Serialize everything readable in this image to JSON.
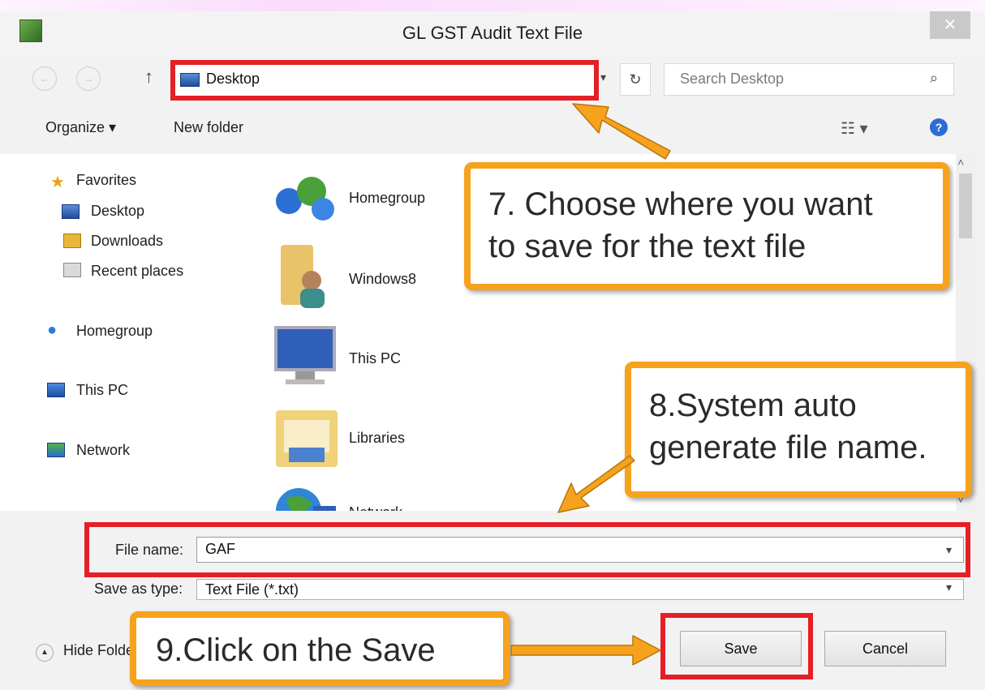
{
  "dialog": {
    "title": "GL GST Audit Text File",
    "close_glyph": "✕"
  },
  "address": {
    "location": "Desktop",
    "search_placeholder": "Search Desktop"
  },
  "toolbar": {
    "organize": "Organize ▾",
    "new_folder": "New folder"
  },
  "nav": {
    "favorites": "Favorites",
    "desktop": "Desktop",
    "downloads": "Downloads",
    "recent_places": "Recent places",
    "homegroup": "Homegroup",
    "this_pc": "This PC",
    "network": "Network"
  },
  "content_items": [
    "Homegroup",
    "Windows8",
    "This PC",
    "Libraries",
    "Network"
  ],
  "fields": {
    "file_name_label": "File name:",
    "file_name_value": "GAF",
    "save_type_label": "Save as type:",
    "save_type_value": "Text File (*.txt)"
  },
  "footer": {
    "hide_folders": "Hide Folders",
    "save": "Save",
    "cancel": "Cancel"
  },
  "callouts": {
    "step7_line1": "7. Choose where you want",
    "step7_line2": "to save for the text file",
    "step8_line1": "8.System auto",
    "step8_line2": "generate file name.",
    "step9": "9.Click on the Save"
  },
  "colors": {
    "highlight_red": "#e41f26",
    "callout_orange": "#f6a21c"
  },
  "icons": [
    "back-icon",
    "forward-icon",
    "up-arrow-icon",
    "refresh-icon",
    "search-icon",
    "view-icon",
    "help-icon",
    "star-icon",
    "folder-icon",
    "homegroup-icon",
    "computer-icon",
    "network-icon",
    "user-folder-icon",
    "libraries-icon"
  ]
}
